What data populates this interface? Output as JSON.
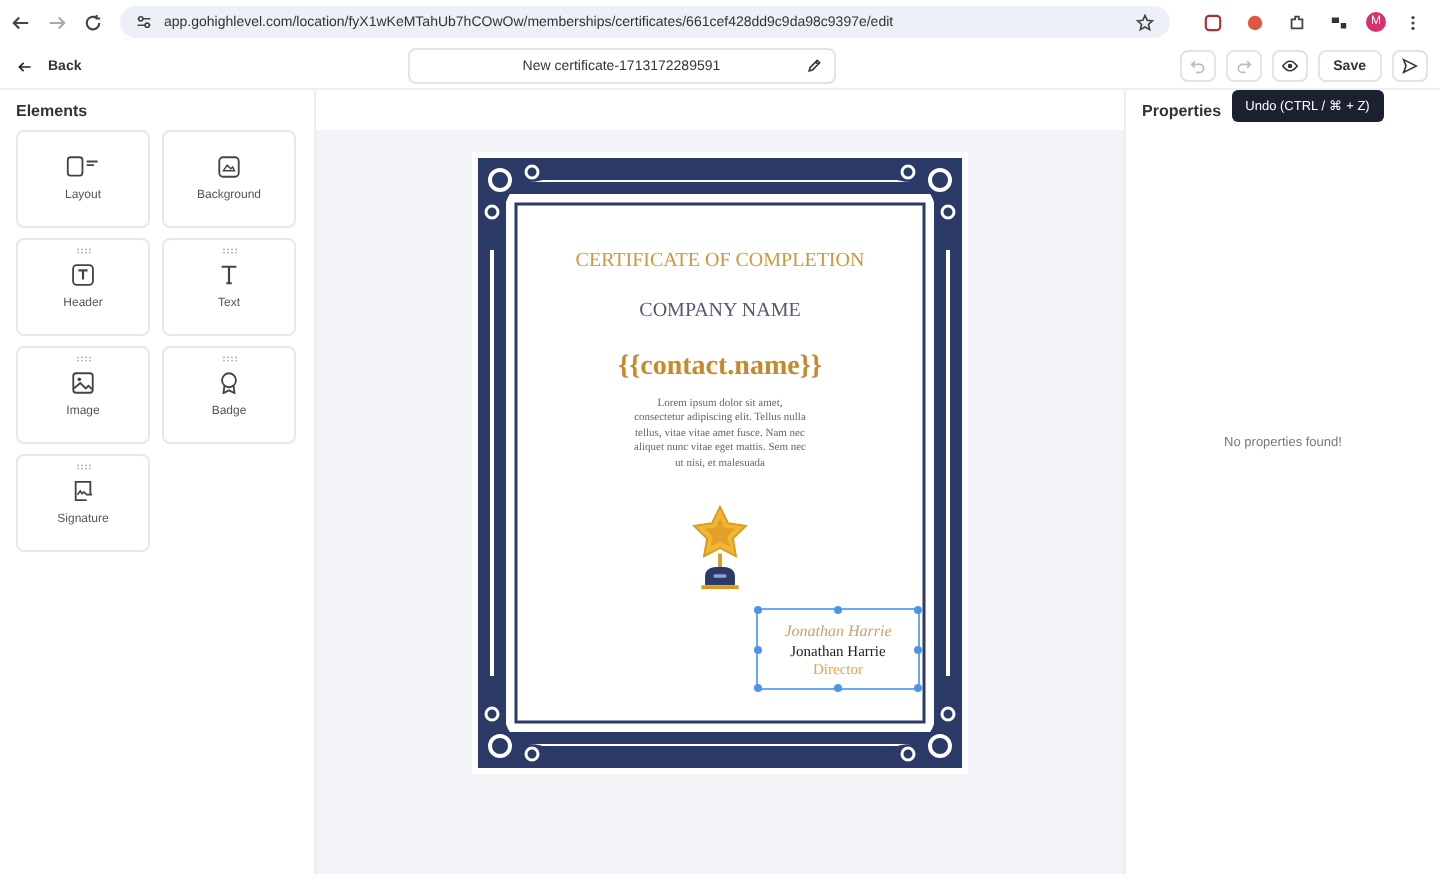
{
  "browser": {
    "url": "app.gohighlevel.com/location/fyX1wKeMTahUb7hCOwOw/memberships/certificates/661cef428dd9c9da98c9397e/edit",
    "profile": "M"
  },
  "header": {
    "back": "Back",
    "title": "New certificate-1713172289591",
    "buttons": [
      {
        "kind": "undo",
        "disabled": true
      },
      {
        "kind": "redo",
        "disabled": true
      },
      {
        "kind": "preview",
        "disabled": false
      },
      {
        "kind": "save",
        "label": "Save",
        "disabled": false
      },
      {
        "kind": "send",
        "disabled": false
      }
    ],
    "tooltip": "Undo (CTRL / ⌘ + Z)"
  },
  "elements": {
    "title": "Elements",
    "items": [
      {
        "kind": "layout",
        "label": "Layout",
        "draggable": false
      },
      {
        "kind": "background",
        "label": "Background",
        "draggable": false
      },
      {
        "kind": "header",
        "label": "Header",
        "draggable": true
      },
      {
        "kind": "text",
        "label": "Text",
        "draggable": true
      },
      {
        "kind": "image",
        "label": "Image",
        "draggable": true
      },
      {
        "kind": "badge",
        "label": "Badge",
        "draggable": true
      },
      {
        "kind": "signature",
        "label": "Signature",
        "draggable": true
      }
    ]
  },
  "certificate": {
    "title": "CERTIFICATE OF COMPLETION",
    "company": "COMPANY NAME",
    "recipient": "{{contact.name}}",
    "body": "Lorem ipsum dolor sit amet, consectetur adipiscing elit. Tellus nulla tellus, vitae vitae amet fusce. Nam nec aliquet nunc vitae eget mattis. Sem nec ut nisi, et malesuada",
    "signature": {
      "script": "Jonathan Harrie",
      "name": "Jonathan Harrie",
      "role": "Director",
      "selected": true
    }
  },
  "properties": {
    "title": "Properties",
    "empty": "No properties found!"
  }
}
